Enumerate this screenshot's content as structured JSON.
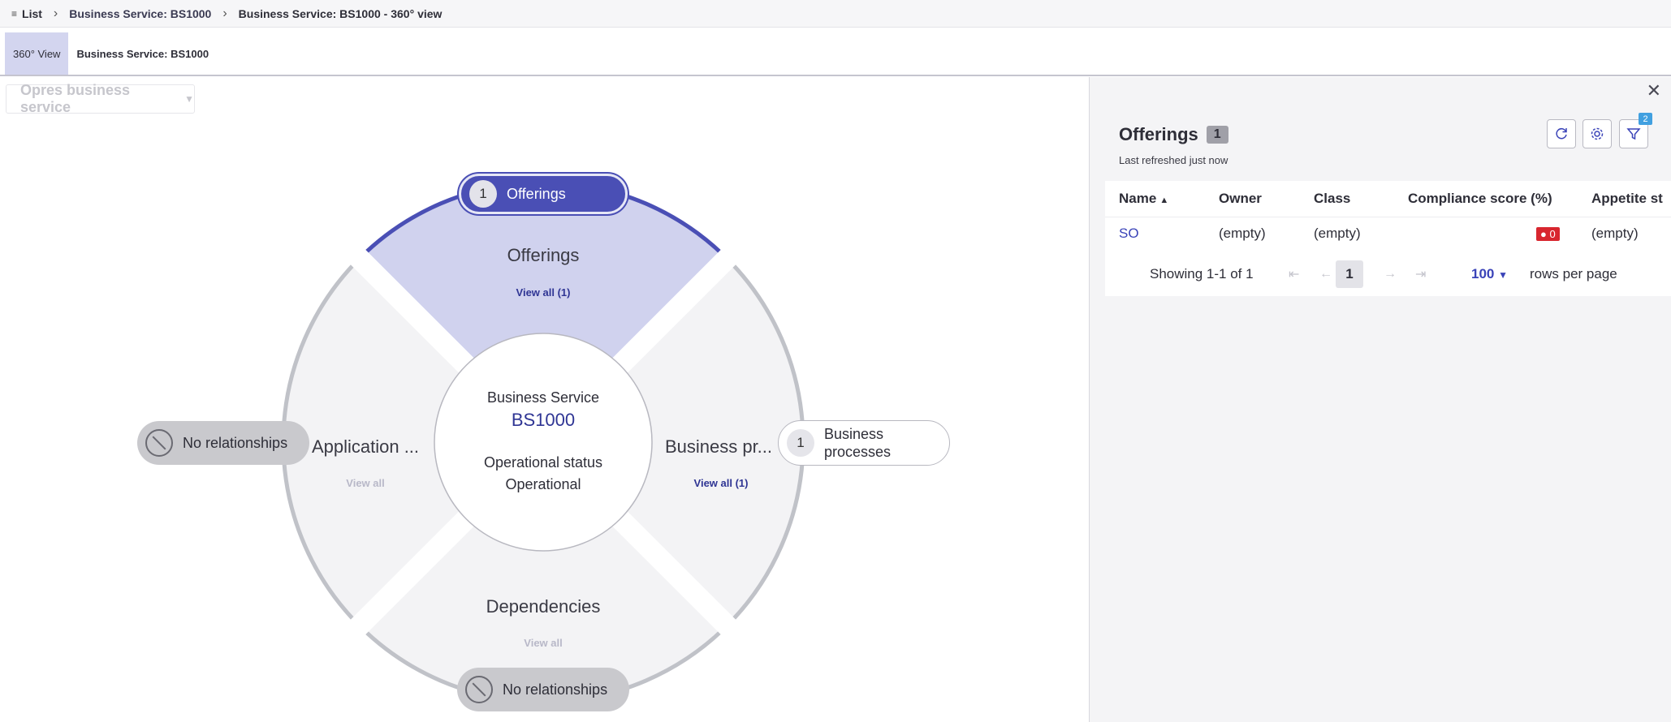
{
  "breadcrumb": {
    "list_label": "List",
    "item1": "Business Service: BS1000",
    "item2": "Business Service: BS1000 - 360° view"
  },
  "tabs": {
    "view360": "360° View",
    "record": "Business Service: BS1000"
  },
  "view_selector": {
    "value": "Opres business service"
  },
  "wheel": {
    "top": {
      "badge_count": "1",
      "badge_label": "Offerings",
      "title": "Offerings",
      "link": "View all (1)"
    },
    "left": {
      "badge_label": "No relationships",
      "title": "Application ...",
      "link": "View all"
    },
    "right": {
      "badge_count": "1",
      "badge_label": "Business processes",
      "title": "Business pr...",
      "link": "View all (1)"
    },
    "bottom": {
      "badge_label": "No relationships",
      "title": "Dependencies",
      "link": "View all"
    },
    "center": {
      "type": "Business Service",
      "id": "BS1000",
      "status_label": "Operational status",
      "status_value": "Operational"
    }
  },
  "panel": {
    "title": "Offerings",
    "count": "1",
    "refreshed": "Last refreshed just now",
    "filter_count": "2",
    "columns": {
      "name": "Name",
      "owner": "Owner",
      "class": "Class",
      "compliance": "Compliance score (%)",
      "appetite": "Appetite st"
    },
    "row": {
      "name": "SO",
      "owner": "(empty)",
      "class": "(empty)",
      "compliance": "0",
      "appetite": "(empty)"
    },
    "pager": {
      "showing": "Showing 1-1 of 1",
      "page": "1",
      "rows": "100",
      "rows_label": "rows per page"
    }
  },
  "colors": {
    "accent": "#4a4fb5",
    "segment_active": "#d0d2ee",
    "segment_idle": "#f3f3f5",
    "error": "#d8262f"
  }
}
